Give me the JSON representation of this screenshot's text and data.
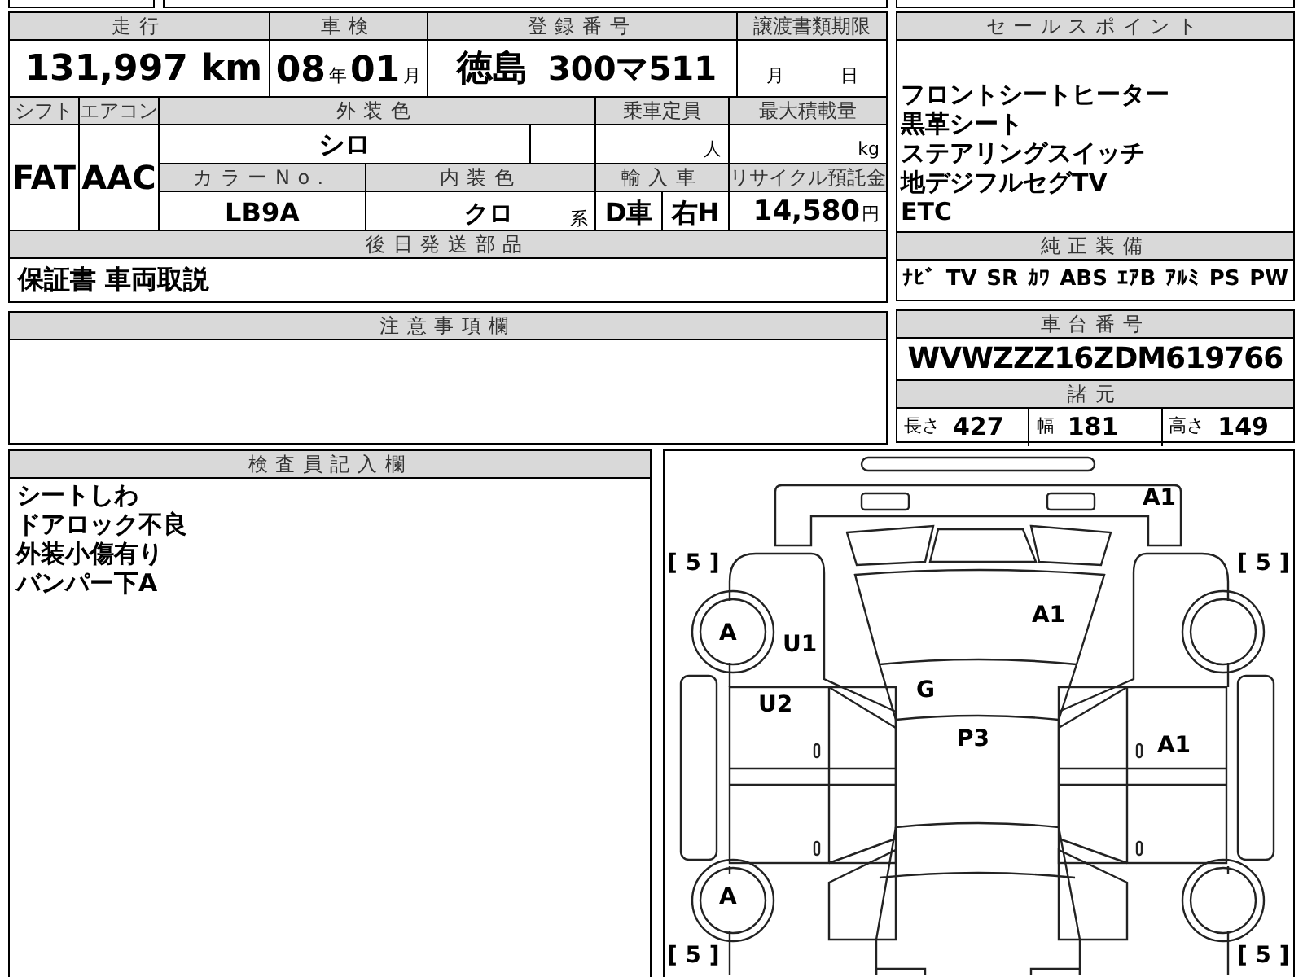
{
  "summary": {
    "mileage": {
      "label": "走行",
      "value": "131,997",
      "unit": "km"
    },
    "inspection": {
      "label": "車検",
      "year": "08",
      "year_unit": "年",
      "month": "01",
      "month_unit": "月"
    },
    "registration": {
      "label": "登録番号",
      "region": "徳島",
      "number": "300マ511"
    },
    "transfer_deadline": {
      "label": "譲渡書類期限",
      "month_unit": "月",
      "day_unit": "日"
    }
  },
  "details": {
    "shift": {
      "label": "シフト",
      "value": "FAT"
    },
    "aircon": {
      "label": "エアコン",
      "value": "AAC"
    },
    "exterior_color": {
      "label": "外装色",
      "value": "シロ"
    },
    "capacity": {
      "label": "乗車定員",
      "unit": "人"
    },
    "max_load": {
      "label": "最大積載量",
      "unit": "kg"
    },
    "color_no": {
      "label": "カラーNo.",
      "value": "LB9A"
    },
    "interior_color": {
      "label": "内装色",
      "value": "クロ",
      "suffix": "系"
    },
    "import": {
      "label": "輸入車",
      "values": [
        "D車",
        "右H"
      ]
    },
    "recycle": {
      "label": "リサイクル預託金",
      "value": "14,580",
      "unit": "円"
    }
  },
  "later_parts": {
    "label": "後日発送部品",
    "value": "保証書 車両取説"
  },
  "notes": {
    "label": "注意事項欄"
  },
  "sales_points": {
    "label": "セールスポイント",
    "items": [
      "フロントシートヒーター",
      "黒革シート",
      "ステアリングスイッチ",
      "地デジフルセグTV",
      "ETC"
    ]
  },
  "equipment": {
    "label": "純正装備",
    "items": [
      "ﾅﾋﾞ",
      "TV",
      "SR",
      "ｶﾜ",
      "ABS",
      "ｴｱB",
      "ｱﾙﾐ",
      "PS",
      "PW"
    ]
  },
  "chassis": {
    "label": "車台番号",
    "value": "WVWZZZ16ZDM619766"
  },
  "specs": {
    "label": "諸元",
    "items": [
      {
        "label": "長さ",
        "value": "427"
      },
      {
        "label": "幅",
        "value": "181"
      },
      {
        "label": "高さ",
        "value": "149"
      }
    ]
  },
  "inspector": {
    "label": "検査員記入欄",
    "lines": [
      "シートしわ",
      "ドアロック不良",
      "外装小傷有り",
      "バンパー下A"
    ]
  },
  "diagram": {
    "marks": [
      "A1",
      "[ 5 ]",
      "[ 5 ]",
      "A",
      "U1",
      "A1",
      "G",
      "U2",
      "P3",
      "A1",
      "A",
      "[ 5 ]",
      "[ 5 ]"
    ]
  }
}
